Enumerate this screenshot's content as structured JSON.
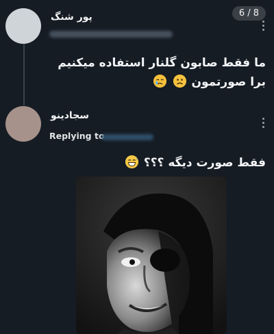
{
  "viewer": {
    "counter": "6 / 8"
  },
  "tweet1": {
    "author": "پور شنگ",
    "text": "ما فقط صابون گلنار استفاده میکنیم برا صورتمون"
  },
  "tweet2": {
    "author": "سجادینو",
    "replying_to_label": "Replying to",
    "text": "فقط صورت دیگه ؟؟؟"
  },
  "icons": {
    "more": "more-vertical-icon",
    "sad_emoji": "frowning-face-emoji",
    "cry_emoji": "crying-face-emoji",
    "grin_emoji": "grinning-sweat-emoji"
  },
  "colors": {
    "background": "#161c24",
    "text": "#f4f6f8",
    "thread_line": "#38434f"
  }
}
